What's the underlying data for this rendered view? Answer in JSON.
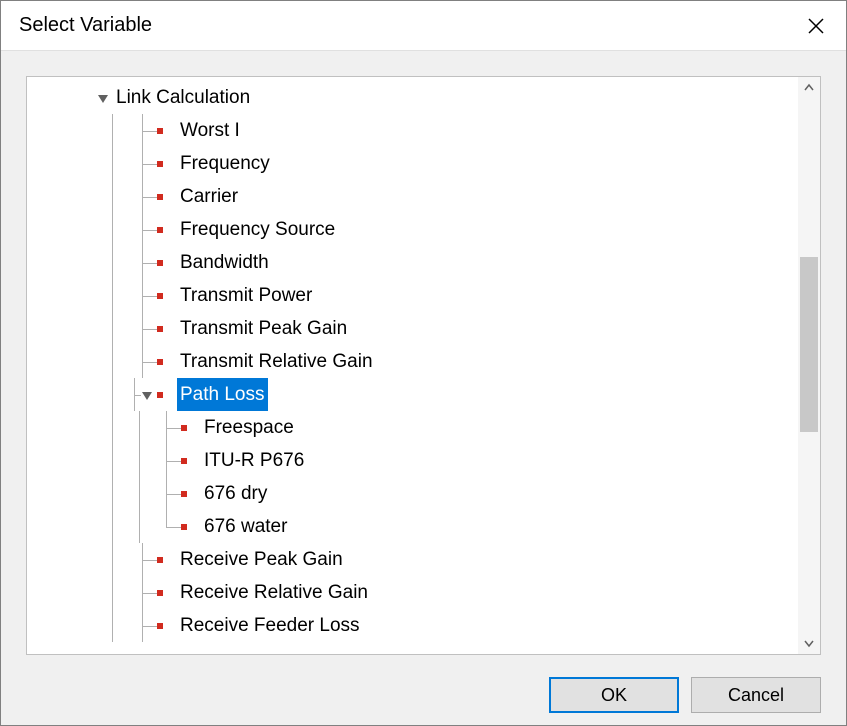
{
  "dialog": {
    "title": "Select Variable",
    "ok_label": "OK",
    "cancel_label": "Cancel"
  },
  "tree": {
    "root": {
      "label": "Link Calculation",
      "children": [
        {
          "label": "Worst I"
        },
        {
          "label": "Frequency"
        },
        {
          "label": "Carrier"
        },
        {
          "label": "Frequency Source"
        },
        {
          "label": "Bandwidth"
        },
        {
          "label": "Transmit Power"
        },
        {
          "label": "Transmit Peak Gain"
        },
        {
          "label": "Transmit Relative Gain"
        },
        {
          "label": "Path Loss",
          "selected": true,
          "children": [
            {
              "label": "Freespace"
            },
            {
              "label": "ITU-R P676"
            },
            {
              "label": "676 dry"
            },
            {
              "label": "676 water"
            }
          ]
        },
        {
          "label": "Receive Peak Gain"
        },
        {
          "label": "Receive Relative Gain"
        },
        {
          "label": "Receive Feeder Loss"
        }
      ]
    }
  }
}
